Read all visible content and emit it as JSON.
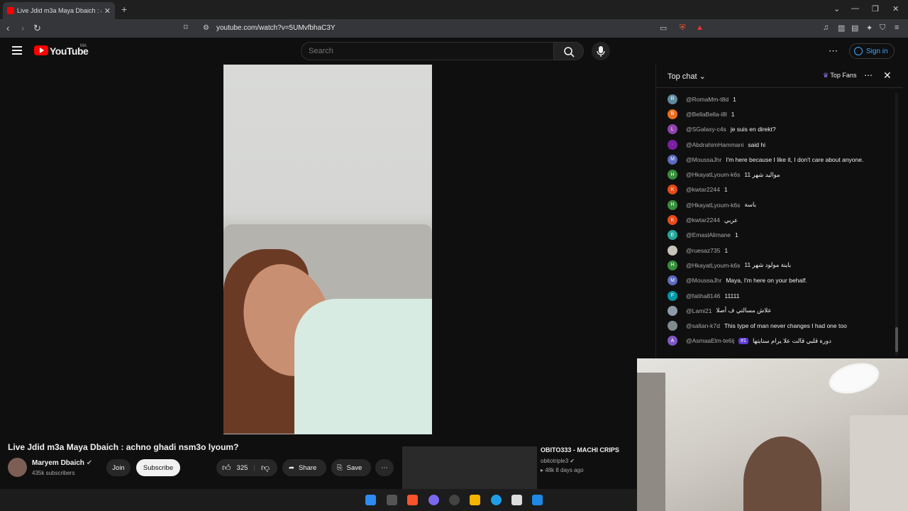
{
  "browser": {
    "tab_title": "Live Jdid m3a Maya Dbaich : a",
    "new_tab": "+",
    "url": "youtube.com/watch?v=5UMvfbhaC3Y"
  },
  "header": {
    "logo_text": "YouTube",
    "country": "MA",
    "search_placeholder": "Search",
    "signin_label": "Sign in"
  },
  "video": {
    "title": "Live Jdid m3a Maya Dbaich : achno ghadi nsm3o lyoum?",
    "channel": "Maryem Dbaich",
    "subscribers": "435k subscribers",
    "join_label": "Join",
    "subscribe_label": "Subscribe",
    "likes": "325",
    "share_label": "Share",
    "save_label": "Save"
  },
  "recommendation": {
    "title": "OBITO333 - MACHI CRIPS",
    "channel": "obitotriple3",
    "meta": "48k  8 days ago"
  },
  "chat": {
    "mode_label": "Top chat",
    "top_fans_label": "Top Fans",
    "messages": [
      {
        "author": "@RomaMm-t8d",
        "text": "1",
        "initial": "R",
        "color": "#5f8a9e"
      },
      {
        "author": "@BellaBella-i8l",
        "text": "1",
        "initial": "B",
        "color": "#e86d1f"
      },
      {
        "author": "@SGalaxy-c4s",
        "text": "je suis en direkt?",
        "initial": "L",
        "color": "#8e44ad"
      },
      {
        "author": "@AbdrahimHammani",
        "text": "said hi",
        "initial": "·",
        "color": "#7b1fa2"
      },
      {
        "author": "@MoussaJhr",
        "text": "I'm here because I like it, I don't care about anyone.",
        "initial": "M",
        "color": "#5c6bc0"
      },
      {
        "author": "@HkayatLyoum-k6s",
        "text": "11 موالید شهر",
        "initial": "H",
        "color": "#388e3c"
      },
      {
        "author": "@kwtar2244",
        "text": "1",
        "initial": "K",
        "color": "#e64a19"
      },
      {
        "author": "@HkayatLyoum-k6s",
        "text": "باسة",
        "initial": "H",
        "color": "#388e3c"
      },
      {
        "author": "@kwtar2244",
        "text": "عربي",
        "initial": "K",
        "color": "#e64a19"
      },
      {
        "author": "@EmaslAlimane",
        "text": "1",
        "initial": "E",
        "color": "#26a69a"
      },
      {
        "author": "@ruesaz735",
        "text": "1",
        "initial": "",
        "color": "#c9c4b8"
      },
      {
        "author": "@HkayatLyoum-k6s",
        "text": "11 باینة مولود شهر",
        "initial": "H",
        "color": "#388e3c"
      },
      {
        "author": "@MoussaJhr",
        "text": "Maya, I'm here on your behalf.",
        "initial": "M",
        "color": "#5c6bc0"
      },
      {
        "author": "@fatiha8146",
        "text": "11111",
        "initial": "F",
        "color": "#0097a7"
      },
      {
        "author": "@Lami21",
        "text": "علاش مسالتي ف أصلا",
        "initial": "",
        "color": "#8d9aa8"
      },
      {
        "author": "@saltan-k7d",
        "text": "This type of man never changes I had one too",
        "initial": "",
        "color": "#7d8a8e"
      },
      {
        "author": "@AsmaaElm-te6ij",
        "text": "دورة قلبي قالت علا يرام سنايتها",
        "initial": "A",
        "color": "#7e57c2",
        "badge": "#1"
      }
    ]
  },
  "icons": {
    "back": "back-arrow-icon",
    "forward": "forward-arrow-icon",
    "reload": "reload-icon",
    "bookmark": "bookmark-icon",
    "search": "search-icon",
    "mic": "mic-icon",
    "like": "thumbs-up-icon",
    "dislike": "thumbs-down-icon"
  }
}
